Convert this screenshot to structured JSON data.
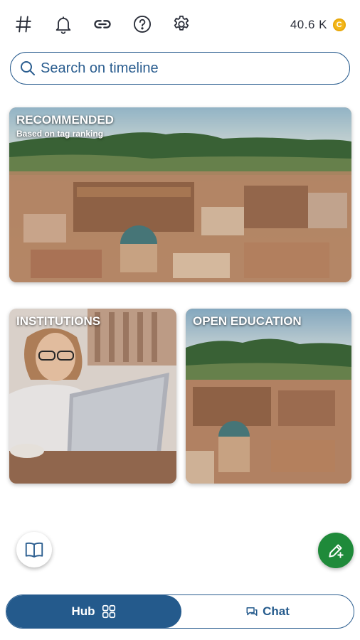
{
  "topbar": {
    "icons": [
      "hashtag-icon",
      "bell-icon",
      "link-icon",
      "help-icon",
      "settings-icon"
    ],
    "balance": "40.6 K",
    "coin_label": "C",
    "coin_color": "#f4b719"
  },
  "search": {
    "placeholder": "Search on timeline"
  },
  "cards": {
    "recommended": {
      "title": "RECOMMENDED",
      "subtitle": "Based on tag ranking"
    },
    "institutions": {
      "title": "INSTITUTIONS"
    },
    "open_education": {
      "title": "OPEN EDUCATION"
    }
  },
  "bottom_nav": {
    "hub_label": "Hub",
    "chat_label": "Chat",
    "active": "Hub"
  },
  "colors": {
    "primary": "#245a8c",
    "accent_green": "#1f8a3a"
  }
}
